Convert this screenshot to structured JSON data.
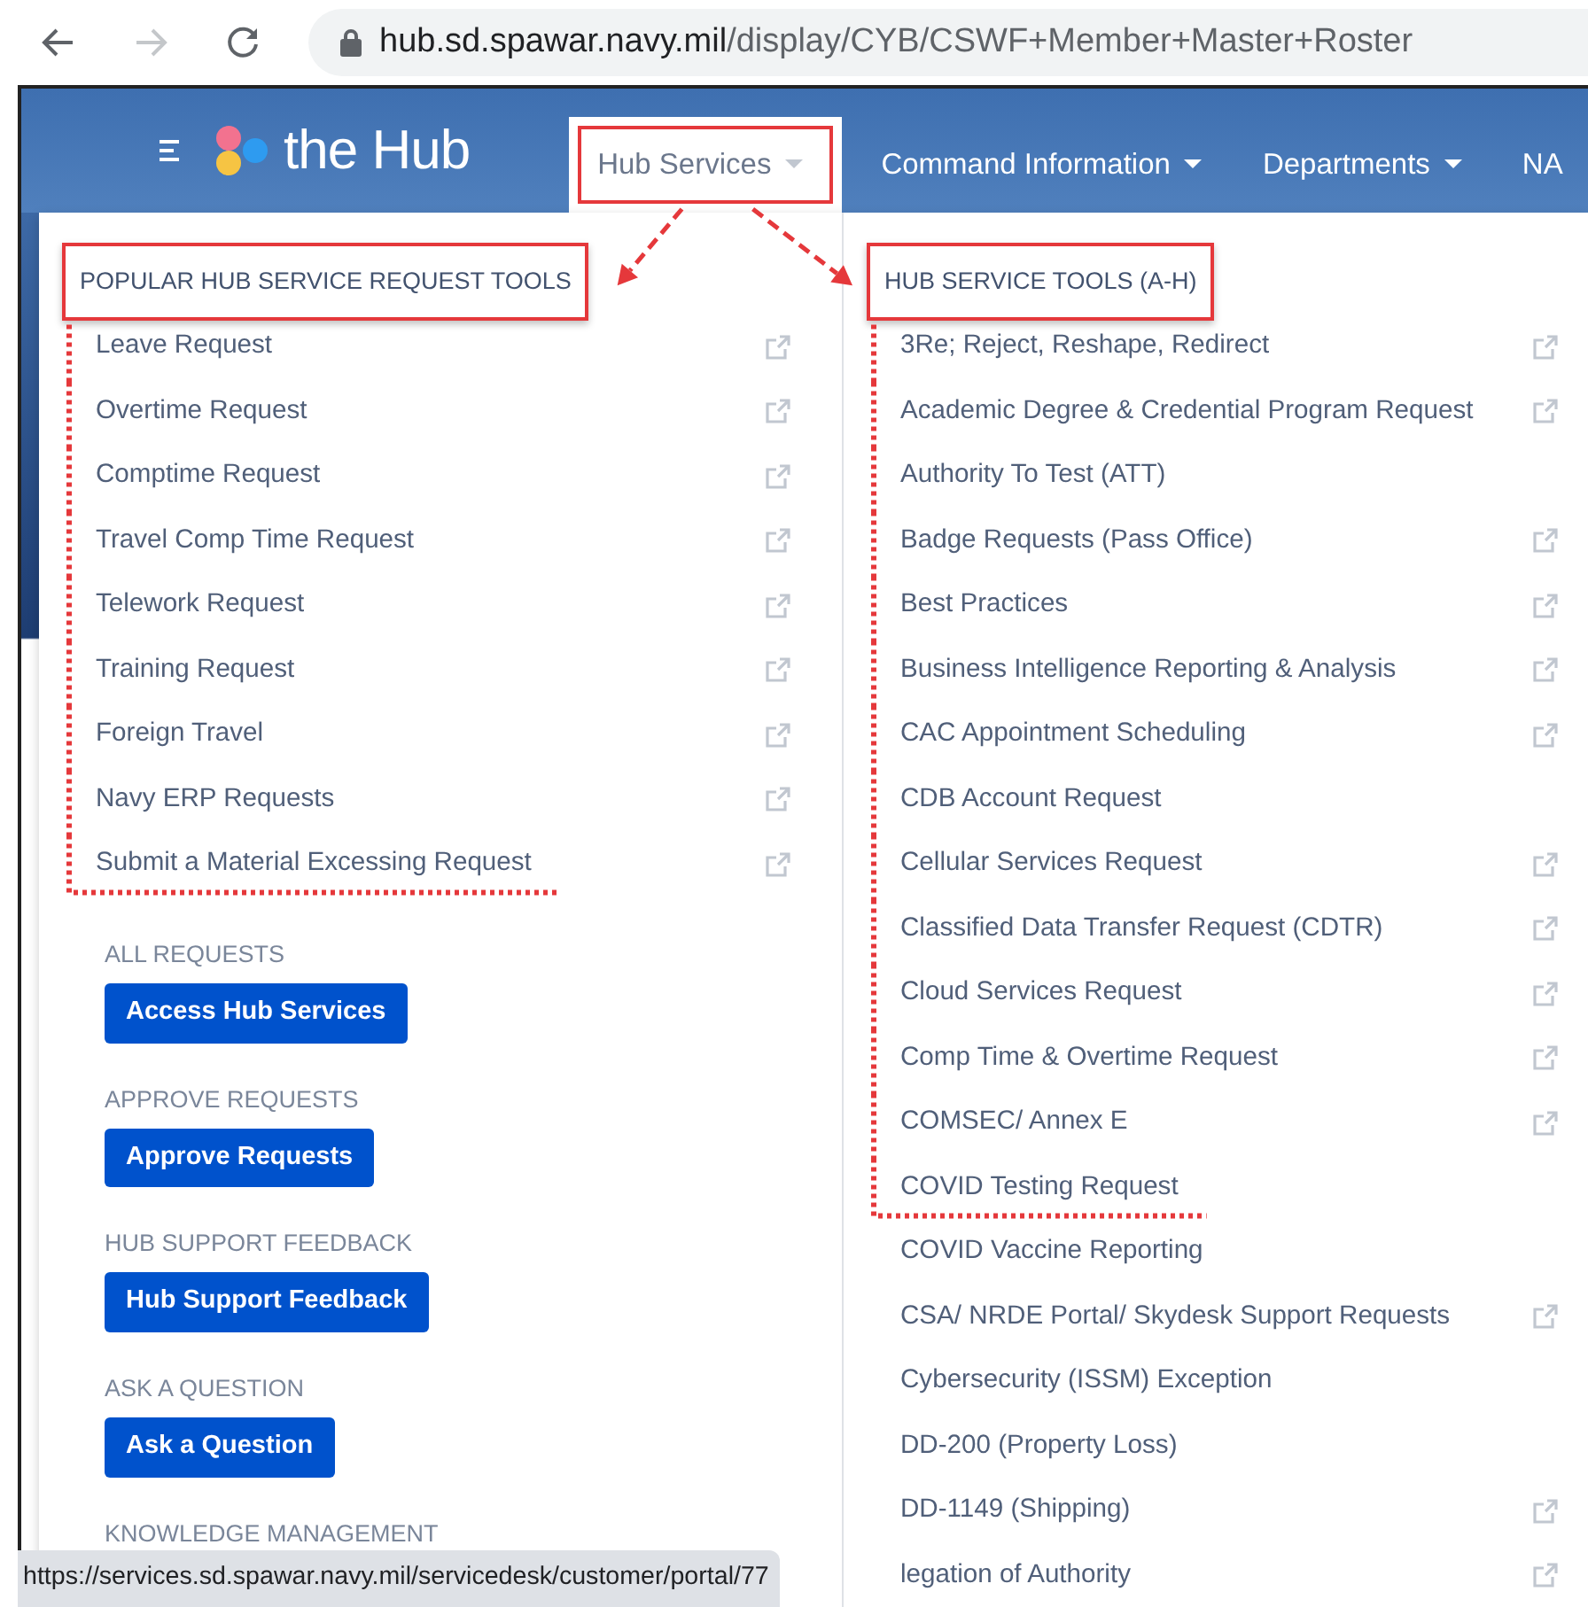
{
  "browser": {
    "url_host": "hub.sd.spawar.navy.mil",
    "url_path": "/display/CYB/CSWF+Member+Master+Roster",
    "forward_disabled": true
  },
  "navbar": {
    "logo": "the Hub",
    "items": [
      {
        "label": "Hub Services",
        "selected": true,
        "highlighted": true,
        "caret": true
      },
      {
        "label": "Command Information",
        "selected": false,
        "highlighted": false,
        "caret": true
      },
      {
        "label": "Departments",
        "selected": false,
        "highlighted": false,
        "caret": true
      },
      {
        "label": "NA",
        "selected": false,
        "highlighted": false,
        "caret": false
      }
    ]
  },
  "menu": {
    "columns": [
      {
        "heading": "POPULAR HUB SERVICE REQUEST TOOLS",
        "highlighted": true,
        "bracketed_items": [
          {
            "label": "Leave Request",
            "external": true
          },
          {
            "label": "Overtime Request",
            "external": true
          },
          {
            "label": "Comptime Request",
            "external": true
          },
          {
            "label": "Travel Comp Time Request",
            "external": true
          },
          {
            "label": "Telework Request",
            "external": true
          },
          {
            "label": "Training Request",
            "external": true
          },
          {
            "label": "Foreign Travel",
            "external": true
          },
          {
            "label": "Navy ERP Requests",
            "external": true
          },
          {
            "label": "Submit a Material Excessing Request",
            "external": true
          }
        ],
        "sections": [
          {
            "label": "ALL REQUESTS",
            "button": "Access Hub Services"
          },
          {
            "label": "APPROVE REQUESTS",
            "button": "Approve Requests"
          },
          {
            "label": "HUB SUPPORT FEEDBACK",
            "button": "Hub Support Feedback"
          },
          {
            "label": "ASK A QUESTION",
            "button": "Ask a Question"
          },
          {
            "label": "KNOWLEDGE MANAGEMENT"
          }
        ]
      },
      {
        "heading": "HUB SERVICE TOOLS (A-H)",
        "highlighted": true,
        "bracketed_items": [
          {
            "label": "3Re; Reject, Reshape, Redirect",
            "external": true
          },
          {
            "label": "Academic Degree & Credential Program Request",
            "external": true
          },
          {
            "label": "Authority To Test (ATT)",
            "external": false
          },
          {
            "label": "Badge Requests (Pass Office)",
            "external": true
          },
          {
            "label": "Best Practices",
            "external": true
          },
          {
            "label": "Business Intelligence Reporting & Analysis",
            "external": true
          },
          {
            "label": "CAC Appointment Scheduling",
            "external": true
          },
          {
            "label": "CDB Account Request",
            "external": false
          },
          {
            "label": "Cellular Services Request",
            "external": true
          },
          {
            "label": "Classified Data Transfer Request (CDTR)",
            "external": true
          },
          {
            "label": "Cloud Services Request",
            "external": true
          },
          {
            "label": "Comp Time & Overtime Request",
            "external": true
          },
          {
            "label": "COMSEC/ Annex E",
            "external": true
          },
          {
            "label": "COVID Testing Request",
            "external": false
          }
        ],
        "items": [
          {
            "label": "COVID Vaccine Reporting",
            "external": false
          },
          {
            "label": "CSA/ NRDE Portal/ Skydesk Support Requests",
            "external": true
          },
          {
            "label": "Cybersecurity (ISSM) Exception",
            "external": false
          },
          {
            "label": "DD-200 (Property Loss)",
            "external": false
          },
          {
            "label": "DD-1149 (Shipping)",
            "external": true
          },
          {
            "label": "legation of Authority",
            "external": true
          }
        ]
      }
    ]
  },
  "status_bar": {
    "url": "https://services.sd.spawar.navy.mil/servicedesk/customer/portal/77"
  }
}
